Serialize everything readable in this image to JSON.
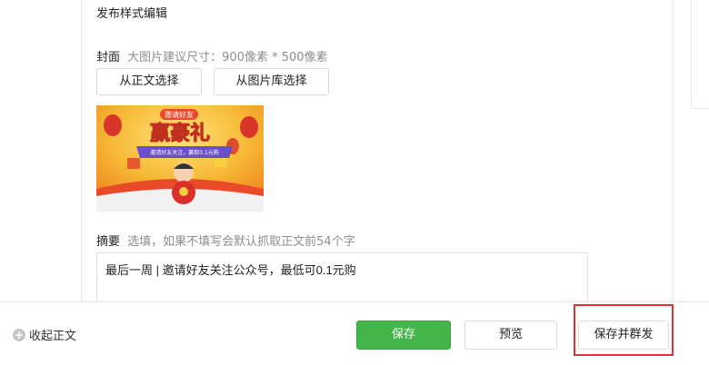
{
  "editor": {
    "section_title": "发布样式编辑"
  },
  "cover": {
    "label": "封面",
    "hint": "大图片建议尺寸：900像素 * 500像素",
    "from_article_button": "从正文选择",
    "from_library_button": "从图片库选择",
    "image": {
      "headline_tag": "邀请好友",
      "headline": "赢豪礼",
      "ribbon_text": "邀请好友关注，赢取0.1元购",
      "colors": {
        "sky": "#f7b834",
        "banner": "#e94a2a",
        "ribbon": "#6a4fc7",
        "headline": "#fff3c0"
      }
    }
  },
  "summary": {
    "label": "摘要",
    "hint": "选填，如果不填写会默认抓取正文前54个字",
    "value": "最后一周 | 邀请好友关注公众号，最低可0.1元购"
  },
  "footer": {
    "collapse_label": "收起正文",
    "save_button": "保存",
    "preview_button": "预览",
    "publish_button": "保存并群发"
  },
  "colors": {
    "primary": "#44b549",
    "highlight": "#e03030"
  }
}
